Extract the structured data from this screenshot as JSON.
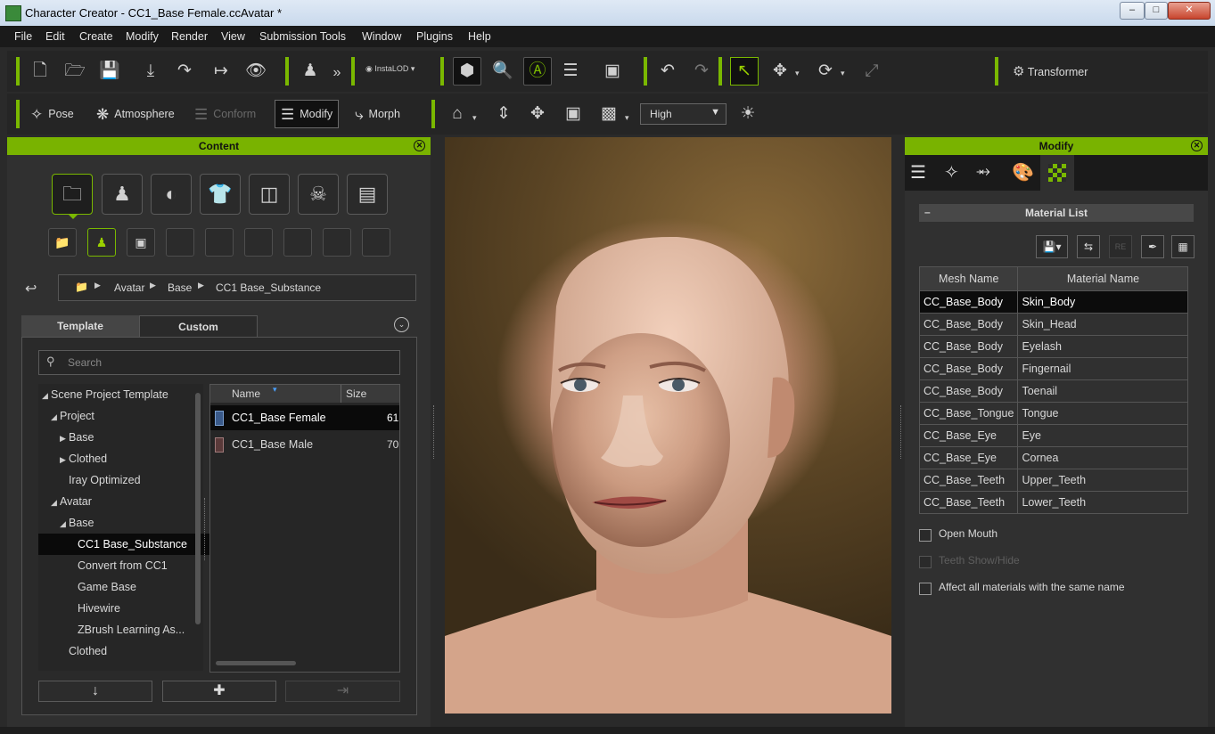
{
  "window": {
    "title": "Character Creator - CC1_Base Female.ccAvatar *"
  },
  "menu": [
    "File",
    "Edit",
    "Create",
    "Modify",
    "Render",
    "View",
    "Submission Tools",
    "Window",
    "Plugins",
    "Help"
  ],
  "toolbar1": {
    "instalod_label": "InstaLOD",
    "transformer_label": "Transformer"
  },
  "toolbar2": {
    "pose_label": "Pose",
    "atmosphere_label": "Atmosphere",
    "conform_label": "Conform",
    "modify_label": "Modify",
    "morph_label": "Morph",
    "quality_value": "High"
  },
  "content_panel": {
    "header": "Content",
    "breadcrumb": [
      "Avatar",
      "Base",
      "CC1 Base_Substance"
    ],
    "tabs": [
      "Template",
      "Custom"
    ],
    "search_placeholder": "Search",
    "tree": [
      {
        "label": "Scene Project Template",
        "indent": 0,
        "arrow": "down"
      },
      {
        "label": "Project",
        "indent": 1,
        "arrow": "down"
      },
      {
        "label": "Base",
        "indent": 2,
        "arrow": "right"
      },
      {
        "label": "Clothed",
        "indent": 2,
        "arrow": "right"
      },
      {
        "label": "Iray Optimized",
        "indent": 2,
        "arrow": ""
      },
      {
        "label": "Avatar",
        "indent": 1,
        "arrow": "down"
      },
      {
        "label": "Base",
        "indent": 2,
        "arrow": "down"
      },
      {
        "label": "CC1 Base_Substance",
        "indent": 3,
        "arrow": "",
        "selected": true
      },
      {
        "label": "Convert from CC1",
        "indent": 3,
        "arrow": ""
      },
      {
        "label": "Game Base",
        "indent": 3,
        "arrow": ""
      },
      {
        "label": "Hivewire",
        "indent": 3,
        "arrow": ""
      },
      {
        "label": "ZBrush Learning As...",
        "indent": 3,
        "arrow": ""
      },
      {
        "label": "Clothed",
        "indent": 2,
        "arrow": ""
      }
    ],
    "list_headers": {
      "name": "Name",
      "size": "Size"
    },
    "list_items": [
      {
        "name": "CC1_Base Female",
        "size": "61",
        "selected": true
      },
      {
        "name": "CC1_Base Male",
        "size": "70",
        "selected": false
      }
    ]
  },
  "modify_panel": {
    "header": "Modify",
    "section_title": "Material List",
    "columns": [
      "Mesh Name",
      "Material Name"
    ],
    "rows": [
      [
        "CC_Base_Body",
        "Skin_Body"
      ],
      [
        "CC_Base_Body",
        "Skin_Head"
      ],
      [
        "CC_Base_Body",
        "Eyelash"
      ],
      [
        "CC_Base_Body",
        "Fingernail"
      ],
      [
        "CC_Base_Body",
        "Toenail"
      ],
      [
        "CC_Base_Tongue",
        "Tongue"
      ],
      [
        "CC_Base_Eye",
        "Eye"
      ],
      [
        "CC_Base_Eye",
        "Cornea"
      ],
      [
        "CC_Base_Teeth",
        "Upper_Teeth"
      ],
      [
        "CC_Base_Teeth",
        "Lower_Teeth"
      ]
    ],
    "selected_row": 0,
    "checkboxes": [
      {
        "label": "Open Mouth",
        "enabled": true
      },
      {
        "label": "Teeth Show/Hide",
        "enabled": false
      },
      {
        "label": "Affect all materials with the same name",
        "enabled": true
      }
    ]
  },
  "colors": {
    "accent": "#79b300",
    "panel_bg": "#303030",
    "menubar_bg": "#1a1a1a"
  }
}
